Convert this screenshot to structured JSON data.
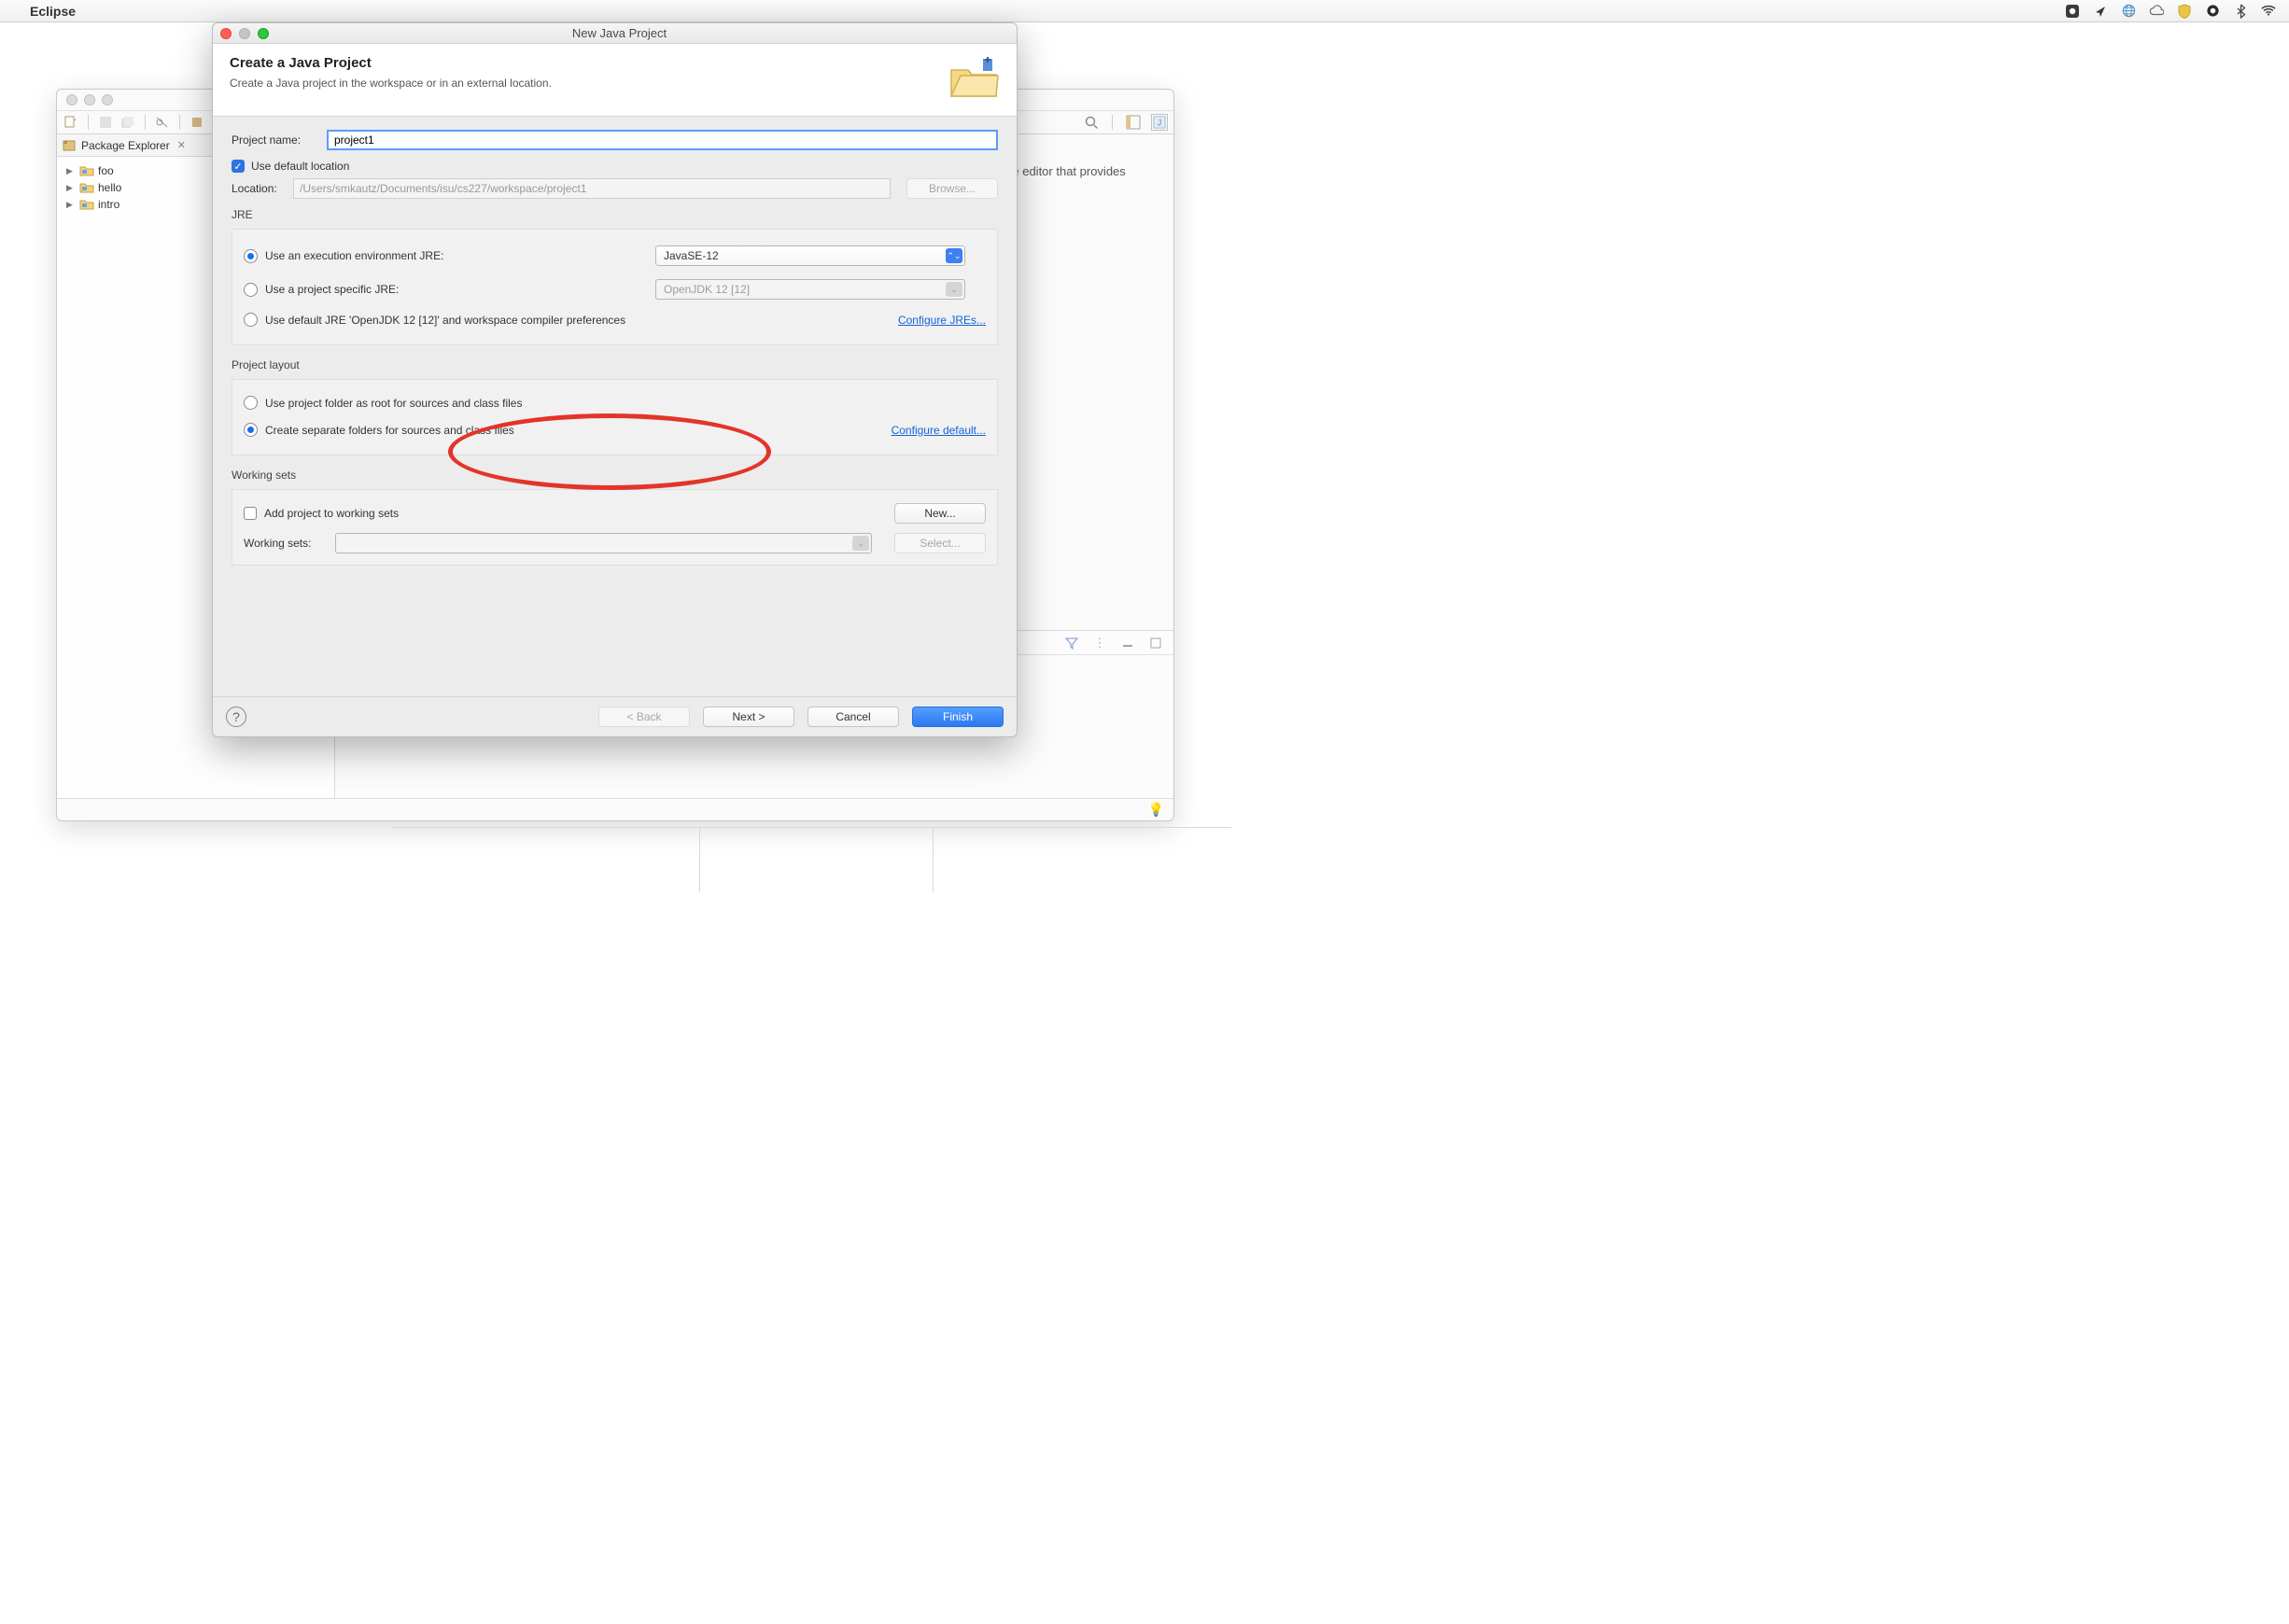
{
  "menubar": {
    "app_name": "Eclipse"
  },
  "eclipse_window": {
    "sidebar_tab": "Package Explorer",
    "projects": [
      "foo",
      "hello",
      "intro"
    ],
    "outline_hint": "There is no active editor that provides an outline."
  },
  "dialog": {
    "window_title": "New Java Project",
    "header_title": "Create a Java Project",
    "header_subtitle": "Create a Java project in the workspace or in an external location.",
    "project_name_label": "Project name:",
    "project_name_value": "project1",
    "use_default_location_label": "Use default location",
    "location_label": "Location:",
    "location_value": "/Users/smkautz/Documents/isu/cs227/workspace/project1",
    "browse_label": "Browse...",
    "jre": {
      "section_title": "JRE",
      "opt_exec_env": "Use an execution environment JRE:",
      "exec_env_value": "JavaSE-12",
      "opt_project_specific": "Use a project specific JRE:",
      "project_specific_value": "OpenJDK 12 [12]",
      "opt_default": "Use default JRE 'OpenJDK 12 [12]' and workspace compiler preferences",
      "configure_link": "Configure JREs..."
    },
    "layout": {
      "section_title": "Project layout",
      "opt_root": "Use project folder as root for sources and class files",
      "opt_separate": "Create separate folders for sources and class files",
      "configure_link": "Configure default..."
    },
    "working_sets": {
      "section_title": "Working sets",
      "add_label": "Add project to working sets",
      "new_label": "New...",
      "ws_label": "Working sets:",
      "select_label": "Select..."
    },
    "buttons": {
      "back": "< Back",
      "next": "Next >",
      "cancel": "Cancel",
      "finish": "Finish"
    }
  }
}
